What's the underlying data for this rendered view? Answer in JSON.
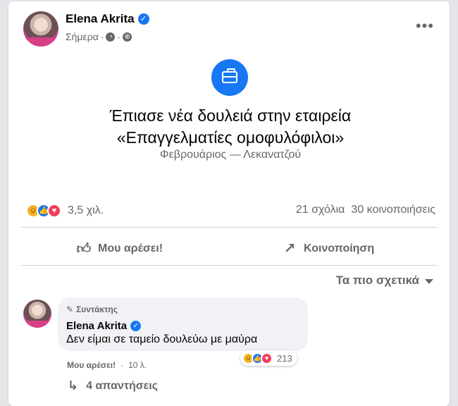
{
  "post": {
    "author": "Elena Akrita",
    "date": "Σήμερα",
    "meta_dot": "·",
    "more_icon": "more-horizontal-icon",
    "headline": "Έπιασε νέα δουλειά στην εταιρεία «Επαγγελματίες ομοφυλόφιλοι»",
    "subline": "Φεβρουάριος — Λεκανατζού",
    "reactions_count": "3,5 χιλ.",
    "comments_count": "21 σχόλια",
    "shares_count": "30 κοινοποιήσεις"
  },
  "actions": {
    "like_label": "Μου αρέσει!",
    "share_label": "Κοινοποίηση"
  },
  "comments_section": {
    "sort_label": "Τα πιο σχετικά"
  },
  "comment": {
    "role": "Συντάκτης",
    "author": "Elena Akrita",
    "text": "Δεν είμαι σε ταμείο δουλεύω με μαύρα",
    "reaction_count": "213",
    "like_action": "Μου αρέσει!",
    "time": "10 λ.",
    "replies": "4 απαντήσεις"
  },
  "colors": {
    "brand_blue": "#1877f2",
    "haha": "#f7b125",
    "love": "#f33e58"
  }
}
